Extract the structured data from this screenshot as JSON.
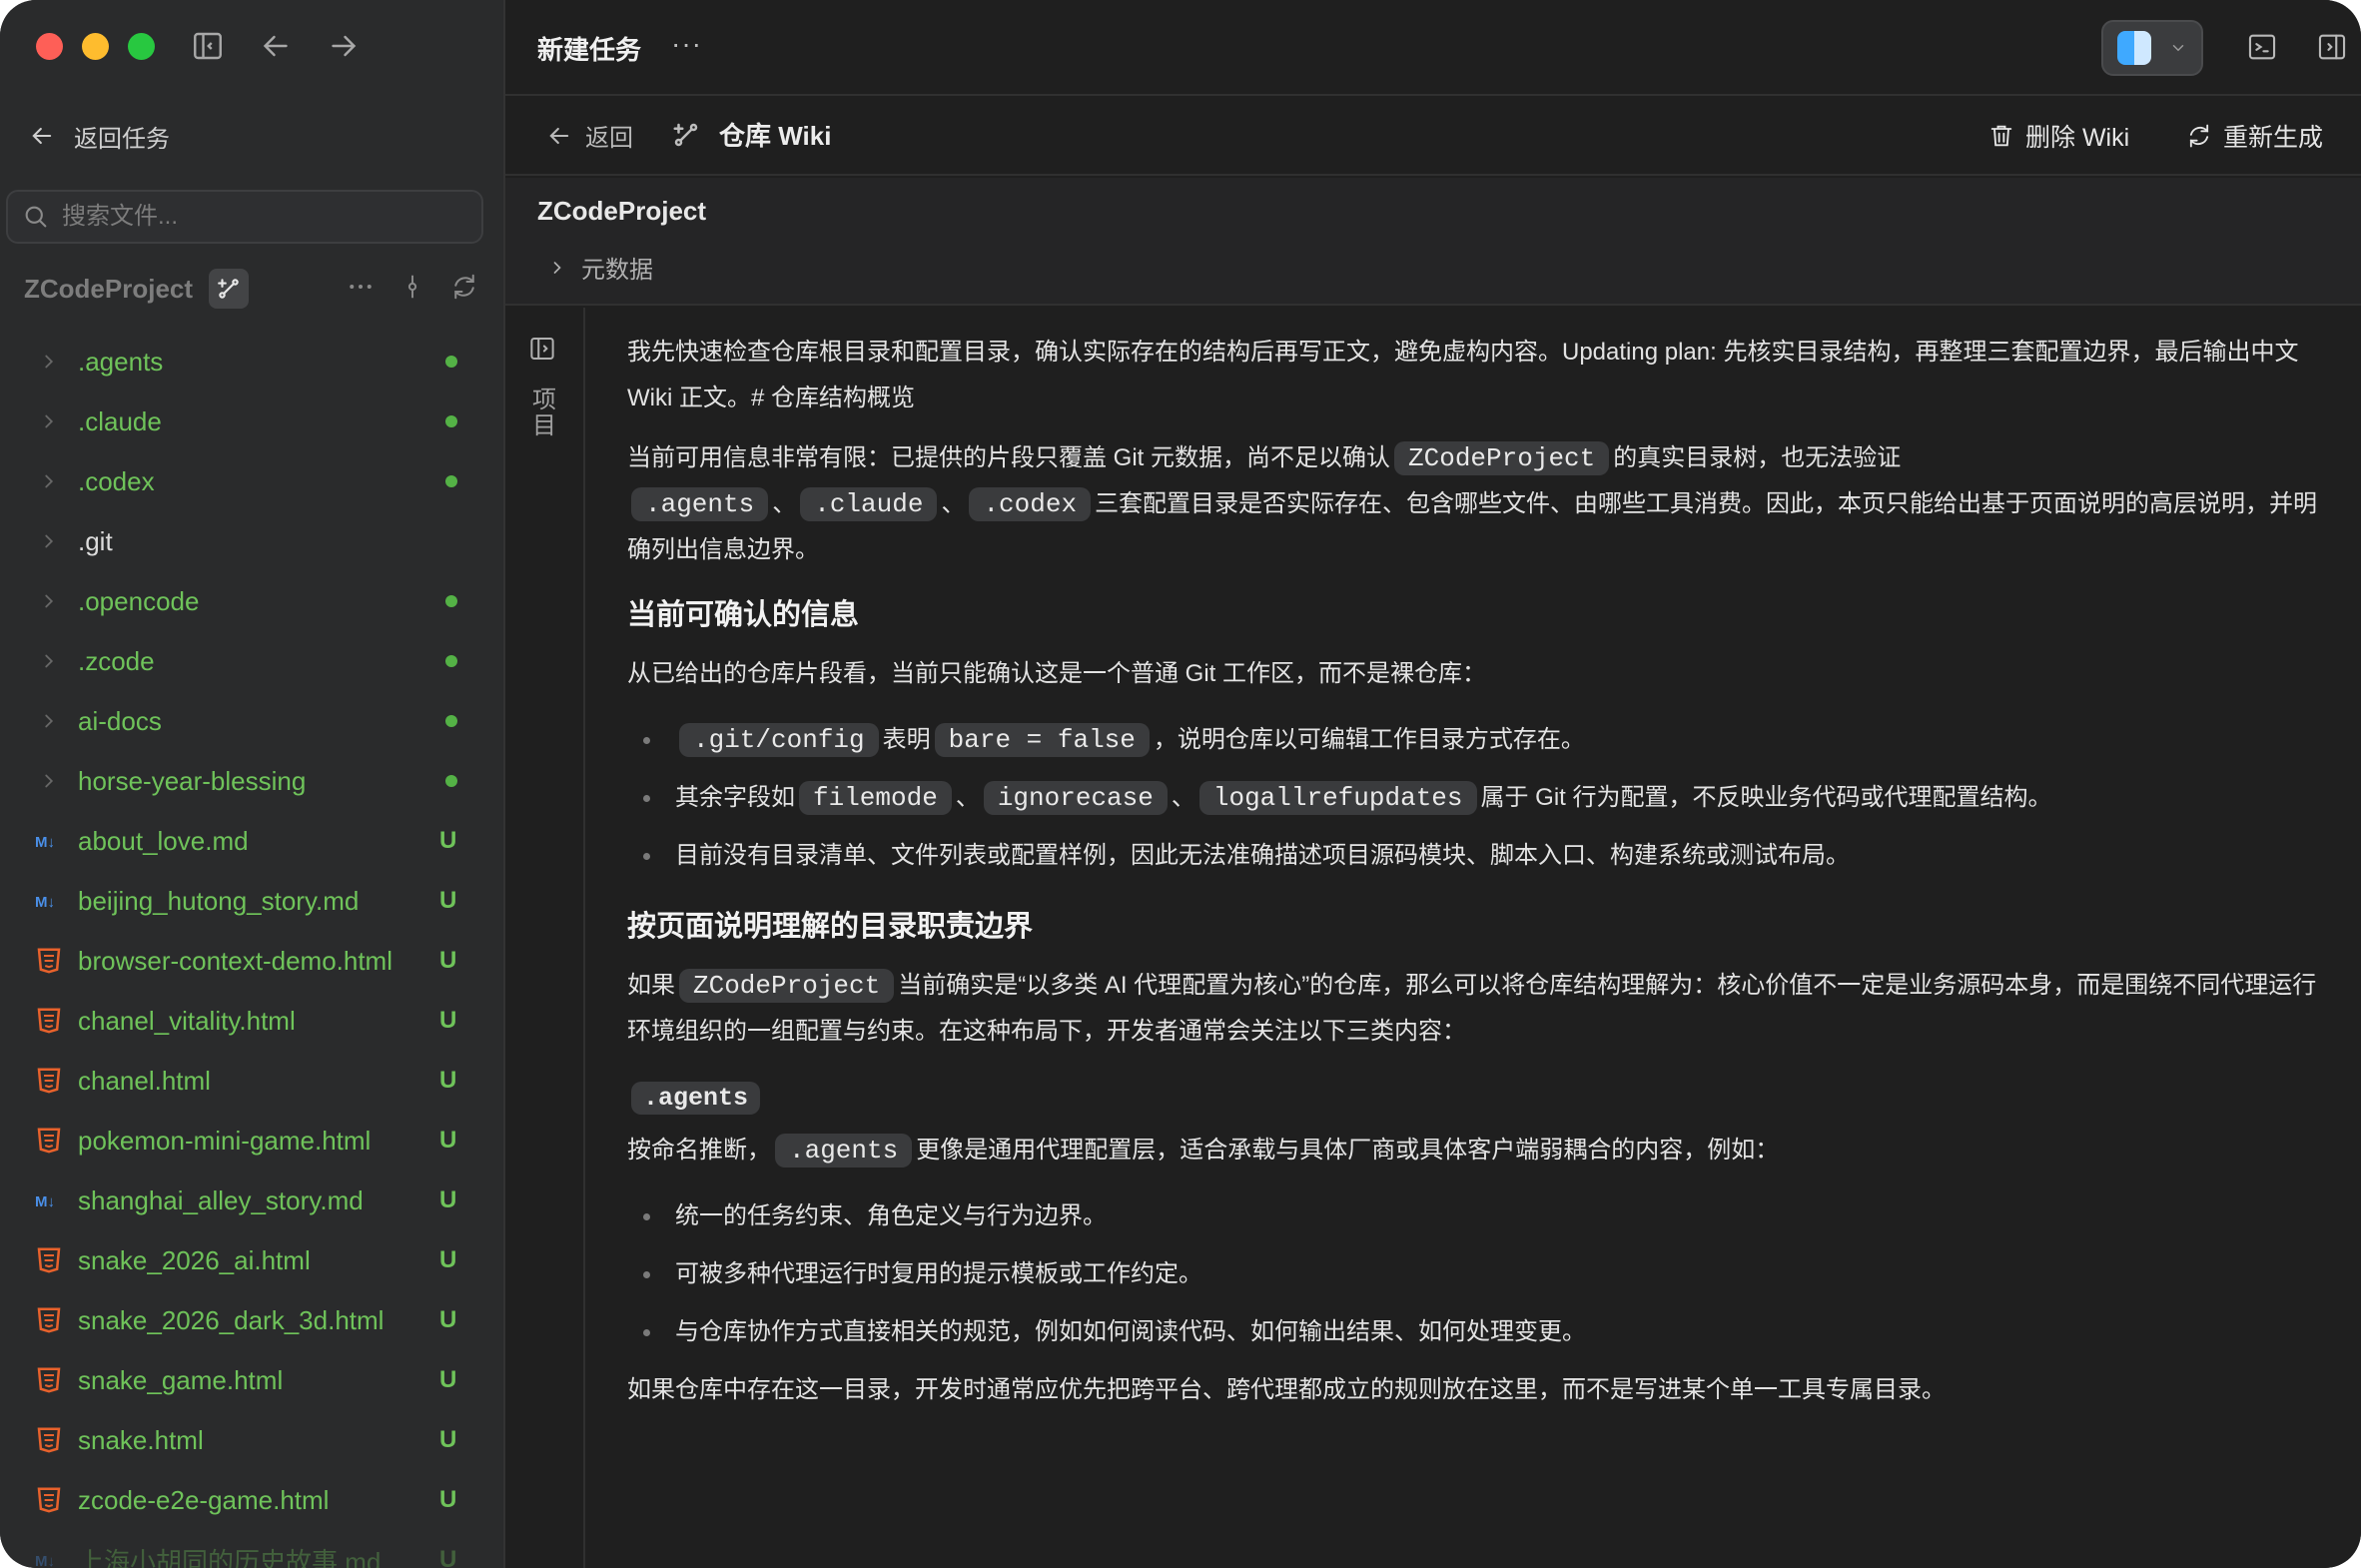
{
  "sidebar": {
    "back_label": "返回任务",
    "search_placeholder": "搜索文件...",
    "project_name": "ZCodeProject",
    "files": [
      {
        "name": ".agents",
        "kind": "folder",
        "status": "dot"
      },
      {
        "name": ".claude",
        "kind": "folder",
        "status": "dot"
      },
      {
        "name": ".codex",
        "kind": "folder",
        "status": "dot"
      },
      {
        "name": ".git",
        "kind": "folder",
        "status": ""
      },
      {
        "name": ".opencode",
        "kind": "folder",
        "status": "dot"
      },
      {
        "name": ".zcode",
        "kind": "folder",
        "status": "dot"
      },
      {
        "name": "ai-docs",
        "kind": "folder",
        "status": "dot"
      },
      {
        "name": "horse-year-blessing",
        "kind": "folder",
        "status": "dot"
      },
      {
        "name": "about_love.md",
        "kind": "markdown",
        "status": "U"
      },
      {
        "name": "beijing_hutong_story.md",
        "kind": "markdown",
        "status": "U"
      },
      {
        "name": "browser-context-demo.html",
        "kind": "html",
        "status": "U"
      },
      {
        "name": "chanel_vitality.html",
        "kind": "html",
        "status": "U"
      },
      {
        "name": "chanel.html",
        "kind": "html",
        "status": "U"
      },
      {
        "name": "pokemon-mini-game.html",
        "kind": "html",
        "status": "U"
      },
      {
        "name": "shanghai_alley_story.md",
        "kind": "markdown",
        "status": "U"
      },
      {
        "name": "snake_2026_ai.html",
        "kind": "html",
        "status": "U"
      },
      {
        "name": "snake_2026_dark_3d.html",
        "kind": "html",
        "status": "U"
      },
      {
        "name": "snake_game.html",
        "kind": "html",
        "status": "U"
      },
      {
        "name": "snake.html",
        "kind": "html",
        "status": "U"
      },
      {
        "name": "zcode-e2e-game.html",
        "kind": "html",
        "status": "U"
      },
      {
        "name": "上海小胡同的历史故事.md",
        "kind": "markdown",
        "status": "U"
      }
    ]
  },
  "titlebar": {
    "title": "新建任务",
    "more": "···"
  },
  "subbar": {
    "back_label": "返回",
    "wiki_label": "仓库 Wiki",
    "delete_label": "删除 Wiki",
    "regen_label": "重新生成"
  },
  "wiki": {
    "project": "ZCodeProject",
    "meta_label": "元数据",
    "toc_label": "项目"
  },
  "content": {
    "p1": "我先快速检查仓库根目录和配置目录，确认实际存在的结构后再写正文，避免虚构内容。Updating plan: 先核实目录结构，再整理三套配置边界，最后输出中文 Wiki 正文。# 仓库结构概览",
    "p2_a": "当前可用信息非常有限：已提供的片段只覆盖 Git 元数据，尚不足以确认",
    "p2_code1": "ZCodeProject",
    "p2_b": "的真实目录树，也无法验证",
    "p2_code2": ".agents",
    "p2_sep1": "、",
    "p2_code3": ".claude",
    "p2_sep2": "、",
    "p2_code4": ".codex",
    "p2_c": "三套配置目录是否实际存在、包含哪些文件、由哪些工具消费。因此，本页只能给出基于页面说明的高层说明，并明确列出信息边界。",
    "h1": "当前可确认的信息",
    "p3": "从已给出的仓库片段看，当前只能确认这是一个普通 Git 工作区，而不是裸仓库：",
    "b1_code1": ".git/config",
    "b1_a": "表明",
    "b1_code2": "bare = false",
    "b1_b": "，说明仓库以可编辑工作目录方式存在。",
    "b2_a": "其余字段如",
    "b2_code1": "filemode",
    "b2_sep1": "、",
    "b2_code2": "ignorecase",
    "b2_sep2": "、",
    "b2_code3": "logallrefupdates",
    "b2_b": "属于 Git 行为配置，不反映业务代码或代理配置结构。",
    "b3": "目前没有目录清单、文件列表或配置样例，因此无法准确描述项目源码模块、脚本入口、构建系统或测试布局。",
    "h2": "按页面说明理解的目录职责边界",
    "p4_a": "如果",
    "p4_code": "ZCodeProject",
    "p4_b": "当前确实是“以多类 AI 代理配置为核心”的仓库，那么可以将仓库结构理解为：核心价值不一定是业务源码本身，而是围绕不同代理运行环境组织的一组配置与约束。在这种布局下，开发者通常会关注以下三类内容：",
    "sec_tag": ".agents",
    "p5_a": "按命名推断，",
    "p5_code": ".agents",
    "p5_b": "更像是通用代理配置层，适合承载与具体厂商或具体客户端弱耦合的内容，例如：",
    "l1": "统一的任务约束、角色定义与行为边界。",
    "l2": "可被多种代理运行时复用的提示模板或工作约定。",
    "l3": "与仓库协作方式直接相关的规范，例如如何阅读代码、如何输出结果、如何处理变更。",
    "p6": "如果仓库中存在这一目录，开发时通常应优先把跨平台、跨代理都成立的规则放在这里，而不是写进某个单一工具专属目录。"
  },
  "colors": {
    "sidebar_bg": "#2a2b2c",
    "main_bg": "#1f1f1f",
    "git_green": "#6fc35a",
    "html_orange": "#e8622c",
    "md_blue": "#4a8fe7"
  }
}
